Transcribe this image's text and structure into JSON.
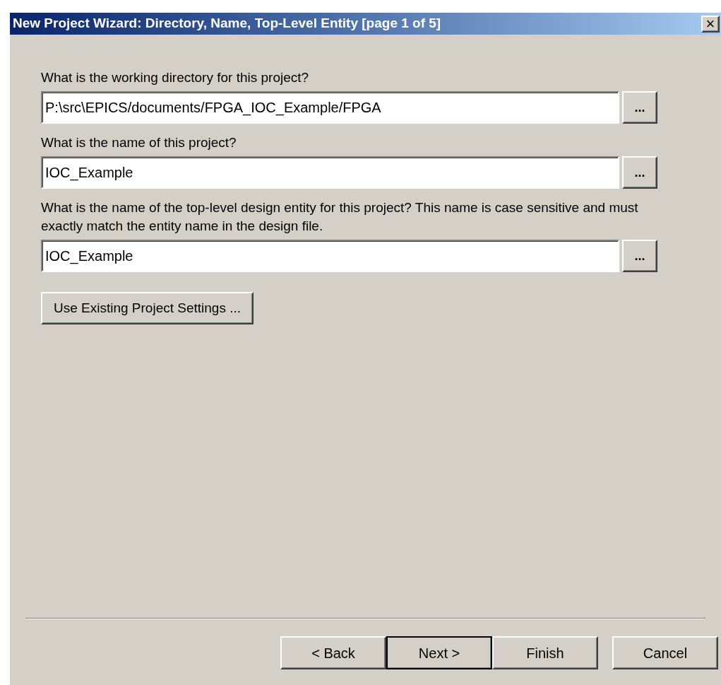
{
  "window": {
    "title": "New Project Wizard: Directory, Name, Top-Level Entity [page 1 of 5]",
    "close": "×"
  },
  "fields": [
    {
      "label": "What is the working directory for this project?",
      "value": "P:\\src\\EPICS/documents/FPGA_IOC_Example/FPGA",
      "browse": "..."
    },
    {
      "label": "What is the name of this project?",
      "value": "IOC_Example",
      "browse": "..."
    },
    {
      "label": "What is the name of the top-level design entity for this project? This name is case sensitive and must exactly match the entity name in the design file.",
      "value": "IOC_Example",
      "browse": "..."
    }
  ],
  "settings_button": "Use Existing Project Settings ...",
  "buttons": [
    {
      "label": "< Back",
      "default": false
    },
    {
      "label": "Next >",
      "default": true
    },
    {
      "label": "Finish",
      "default": false
    },
    {
      "label": "Cancel",
      "default": false
    }
  ]
}
